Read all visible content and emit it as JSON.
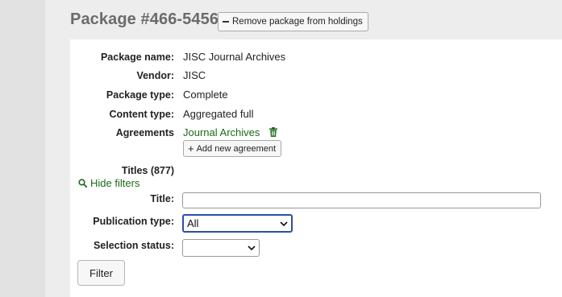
{
  "header": {
    "title": "Package #466-5456",
    "remove_button": "Remove package from holdings"
  },
  "details": {
    "package_name_label": "Package name:",
    "package_name_value": "JISC Journal Archives",
    "vendor_label": "Vendor:",
    "vendor_value": "JISC",
    "package_type_label": "Package type:",
    "package_type_value": "Complete",
    "content_type_label": "Content type:",
    "content_type_value": "Aggregated full",
    "agreements_label": "Agreements",
    "agreement_link": "Journal Archives",
    "add_agreement_button": "Add new agreement"
  },
  "titles": {
    "heading": "Titles (877)",
    "hide_filters": "Hide filters",
    "title_filter_label": "Title:",
    "title_filter_value": "",
    "publication_type_label": "Publication type:",
    "publication_type_selected": "All",
    "selection_status_label": "Selection status:",
    "selection_status_selected": "",
    "filter_button": "Filter"
  },
  "colors": {
    "link_green": "#1a6b1a",
    "focus_blue": "#2a4fa8",
    "title_gray": "#6b6b6b"
  }
}
